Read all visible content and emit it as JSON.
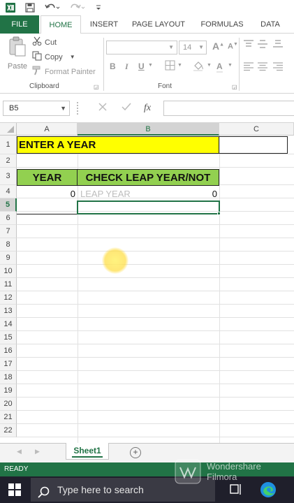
{
  "ribbon_tabs": [
    {
      "label": "FILE"
    },
    {
      "label": "HOME"
    },
    {
      "label": "INSERT"
    },
    {
      "label": "PAGE LAYOUT"
    },
    {
      "label": "FORMULAS"
    },
    {
      "label": "DATA"
    }
  ],
  "clipboard": {
    "paste_label": "Paste",
    "cut_label": "Cut",
    "copy_label": "Copy",
    "format_painter_label": "Format Painter",
    "group_label": "Clipboard"
  },
  "font": {
    "size_value": "14",
    "group_label": "Font",
    "bold": "B",
    "italic": "I",
    "underline": "U",
    "font_color_letter": "A",
    "grow_letter": "A",
    "shrink_letter": "A"
  },
  "formula_bar": {
    "name_box": "B5",
    "fx_label": "fx"
  },
  "columns": [
    {
      "label": "A"
    },
    {
      "label": "B"
    },
    {
      "label": "C"
    }
  ],
  "rows": [
    "1",
    "2",
    "3",
    "4",
    "5",
    "6",
    "7",
    "8",
    "9",
    "10",
    "11",
    "12",
    "13",
    "14",
    "15",
    "16",
    "17",
    "18",
    "19",
    "20",
    "21",
    "22"
  ],
  "cells": {
    "a1": "ENTER A YEAR",
    "a3": "YEAR",
    "b3": "CHECK LEAP YEAR/NOT",
    "a4": "0",
    "b4_placeholder": "LEAP YEAR",
    "b4_value": "0"
  },
  "sheet_tabs": [
    {
      "label": "Sheet1"
    }
  ],
  "status": {
    "mode": "READY"
  },
  "taskbar": {
    "search_placeholder": "Type here to search"
  },
  "watermark": {
    "line1": "Wondershare",
    "line2": "Filmora"
  },
  "colors": {
    "excel_green": "#217346",
    "title_fill": "#ffff00",
    "header_fill": "#92d050",
    "selection_border": "#217346"
  }
}
